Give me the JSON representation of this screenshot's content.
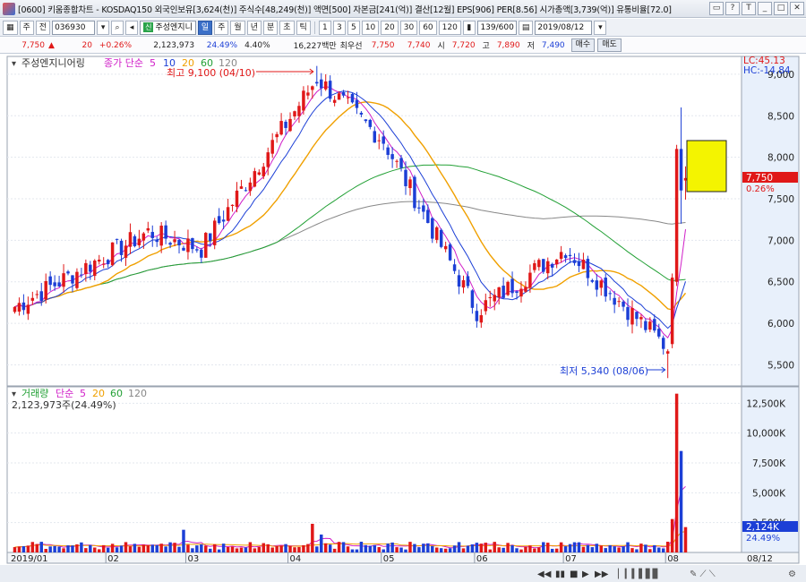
{
  "window": {
    "title": "[0600] 키움종합차트 - KOSDAQ150 외국인보유[3,624(천)] 주식수[48,249(천)] 액면[500] 자본금[241(억)] 결산[12월] EPS[906] PER[8.56] 시가총액[3,739(억)] 유통비율[72.0]",
    "buttons": [
      "▭",
      "?",
      "T",
      "_",
      "□",
      "✕"
    ]
  },
  "toolbar": {
    "mode": "주",
    "mode2": "전",
    "code": "036930",
    "stock_name": "주성엔지니",
    "stock_badge": "신",
    "periods": [
      "일",
      "주",
      "월",
      "년",
      "분",
      "초",
      "틱"
    ],
    "active_period": "일",
    "minutes": [
      "1",
      "3",
      "5",
      "10",
      "20",
      "30",
      "60",
      "120"
    ],
    "count": "139/600",
    "date": "2019/08/12"
  },
  "quote": {
    "price": "7,750",
    "change": "20",
    "change_pct": "+0.26%",
    "volume": "2,123,973",
    "vol_pct": "24.49%",
    "turnover": "4.40%",
    "amount": "16,227백만",
    "priority_label": "최우선",
    "ask": "7,750",
    "bid": "7,740",
    "open_label": "시",
    "open": "7,720",
    "high_label": "고",
    "high": "7,890",
    "low_label": "저",
    "low": "7,490",
    "buy_button": "매수",
    "sell_button": "매도"
  },
  "price_panel": {
    "name": "주성엔지니어링",
    "ma_label": "종가 단순",
    "ma_periods": [
      "5",
      "10",
      "20",
      "60",
      "120"
    ],
    "lc": "LC:45.13",
    "hc": "HC:-14.84",
    "max_note": "최고 9,100 (04/10)",
    "min_note": "최저 5,340 (08/06)",
    "current_tag": "7,750",
    "current_pct": "0.26%",
    "y_ticks": [
      "9,000",
      "8,500",
      "8,000",
      "7,500",
      "7,000",
      "6,500",
      "6,000",
      "5,500"
    ]
  },
  "volume_panel": {
    "label": "거래량",
    "ma_label": "단순",
    "ma_periods": [
      "5",
      "20",
      "60",
      "120"
    ],
    "current_text": "2,123,973주(24.49%)",
    "y_ticks": [
      "12,500K",
      "10,000K",
      "7,500K",
      "5,000K",
      "2,500K"
    ],
    "current_tag": "2,124K",
    "current_pct": "24.49%"
  },
  "x_axis": {
    "labels": [
      "2019/01",
      "02",
      "03",
      "04",
      "05",
      "06",
      "07",
      "08"
    ],
    "right_label": "08/12"
  },
  "colors": {
    "up": "#e01818",
    "down": "#1c3fd6",
    "ma5": "#d01ec8",
    "ma10": "#1c3fd6",
    "ma20": "#f0a000",
    "ma60": "#22a035",
    "ma120": "#888888",
    "axis_bg": "#e8f0fb",
    "box": "#f4f400"
  },
  "chart_data": {
    "type": "candlestick",
    "note": "Daily OHLC and volume series, 2019/01 – 2019/08/12",
    "x_range": [
      "2019/01/02",
      "2019/08/12"
    ],
    "price_ylim": [
      5300,
      9150
    ],
    "volume_ylim": [
      0,
      13500
    ],
    "last": {
      "open": 7720,
      "high": 7890,
      "low": 7490,
      "close": 7750,
      "volume": 2124
    },
    "anchors": [
      {
        "date": "2019/01/02",
        "close": 6200
      },
      {
        "date": "2019/02/15",
        "close": 7100
      },
      {
        "date": "2019/03/05",
        "close": 6900
      },
      {
        "date": "2019/04/10",
        "close": 8950,
        "high": 9100
      },
      {
        "date": "2019/05/02",
        "close": 8200
      },
      {
        "date": "2019/06/03",
        "close": 6150
      },
      {
        "date": "2019/07/01",
        "close": 6900
      },
      {
        "date": "2019/08/06",
        "close": 5700,
        "low": 5340
      },
      {
        "date": "2019/08/12",
        "close": 7750
      }
    ]
  }
}
